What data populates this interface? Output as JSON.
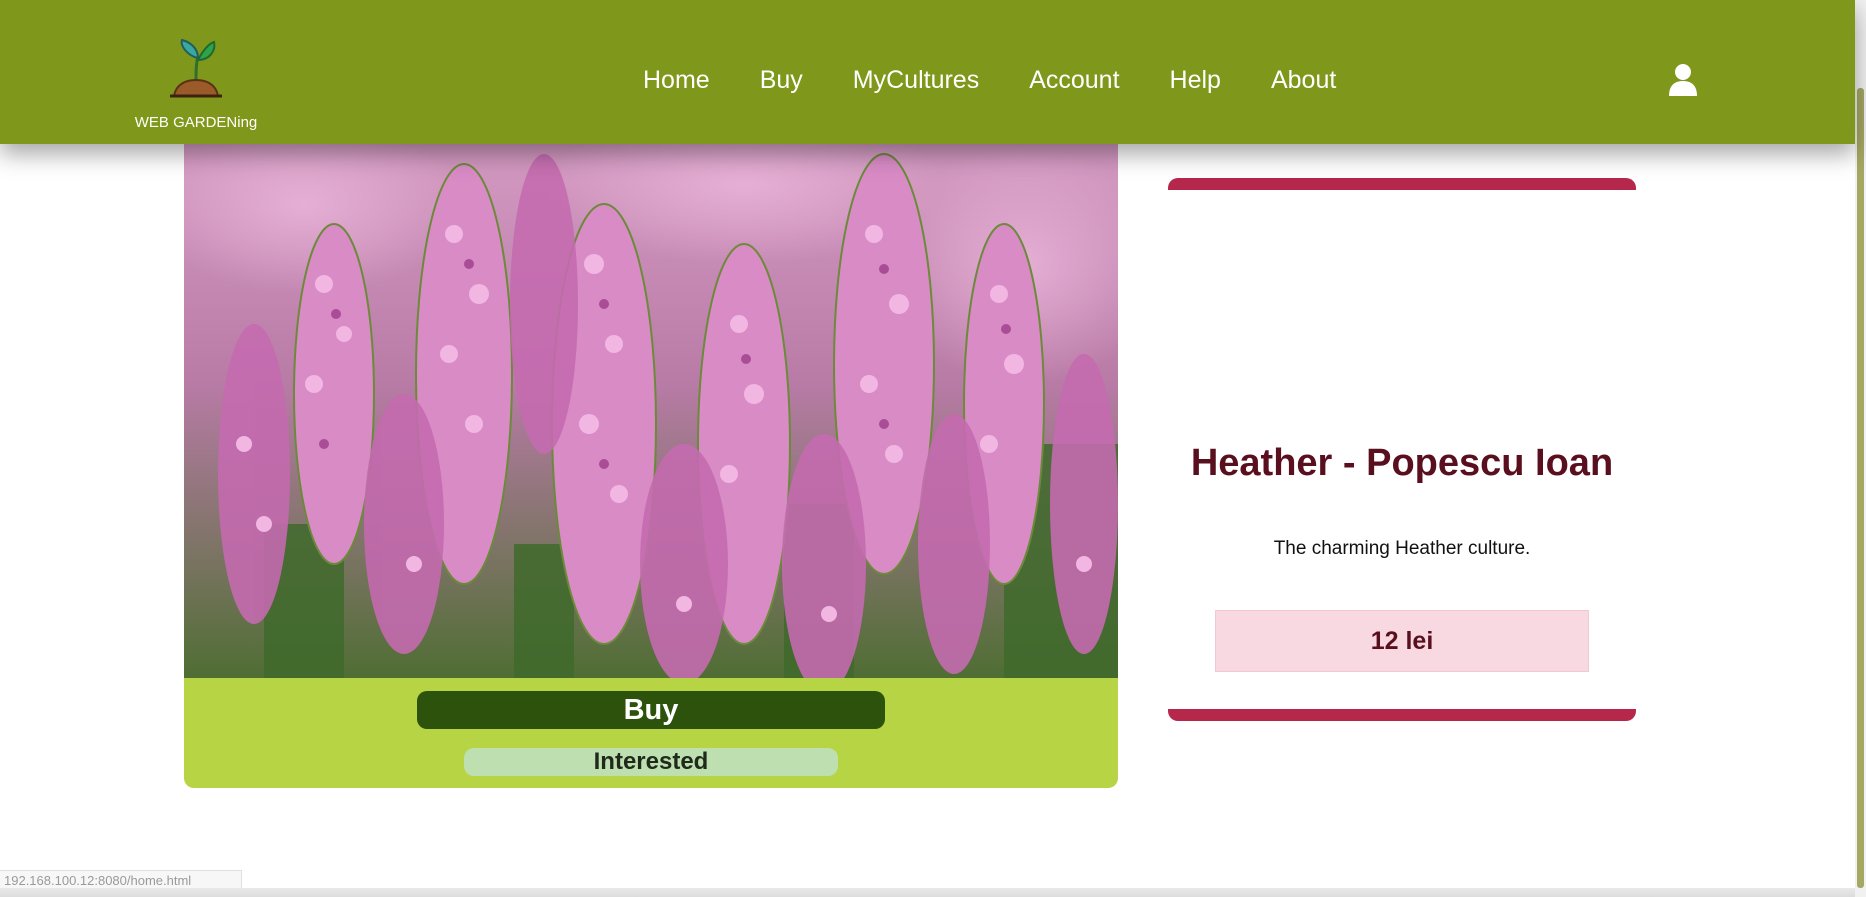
{
  "header": {
    "logo_text": "WEB GARDENing",
    "nav": [
      {
        "label": "Home"
      },
      {
        "label": "Buy"
      },
      {
        "label": "MyCultures"
      },
      {
        "label": "Account"
      },
      {
        "label": "Help"
      },
      {
        "label": "About"
      }
    ],
    "user_icon": "user-icon",
    "background": "#7f971a"
  },
  "product": {
    "image": "heather-flowers-photo",
    "title": "Heather - Popescu Ioan",
    "description": "The charming Heather culture.",
    "price": "12 lei",
    "buy_label": "Buy",
    "interested_label": "Interested"
  },
  "colors": {
    "accent": "#b5284c",
    "buy_button": "#2c520b",
    "card_bg": "#b7d445",
    "price_bg": "#f9d9e1"
  },
  "status_bar": {
    "url": "192.168.100.12:8080/home.html"
  }
}
